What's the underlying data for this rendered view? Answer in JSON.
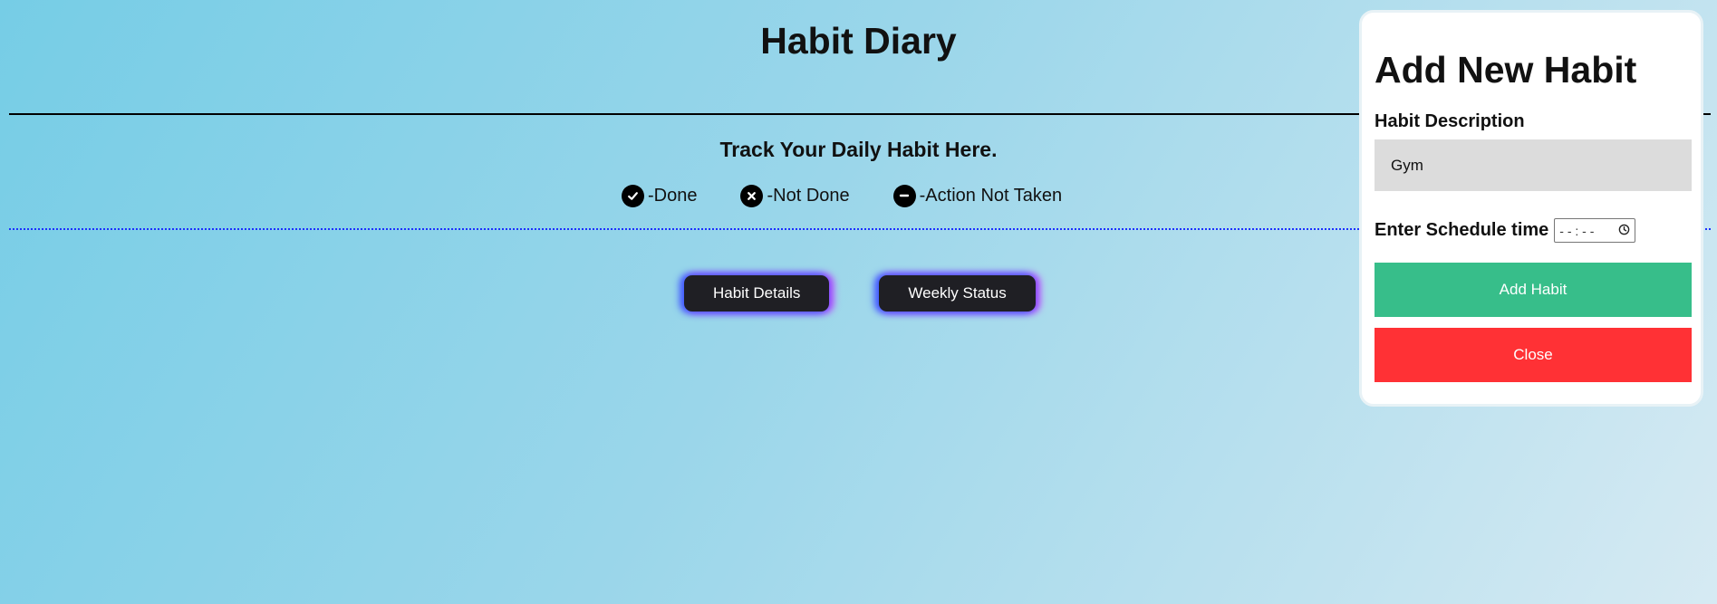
{
  "header": {
    "title": "Habit Diary"
  },
  "main": {
    "subtitle": "Track Your Daily Habit Here.",
    "legend": [
      {
        "icon": "check-icon",
        "label": "-Done"
      },
      {
        "icon": "x-icon",
        "label": "-Not Done"
      },
      {
        "icon": "minus-icon",
        "label": "-Action Not Taken"
      }
    ],
    "buttons": {
      "habit_details": "Habit Details",
      "weekly_status": "Weekly Status"
    }
  },
  "modal": {
    "title": "Add New Habit",
    "description_label": "Habit Description",
    "description_value": "Gym",
    "schedule_label": "Enter Schedule time",
    "time_placeholder": "- - : - -",
    "add_label": "Add Habit",
    "close_label": "Close"
  },
  "colors": {
    "add_button": "#37be8a",
    "close_button": "#ff3135",
    "dotted_divider": "#1c2fff",
    "glow_left": "#3c5bff",
    "glow_right": "#c040ff"
  }
}
